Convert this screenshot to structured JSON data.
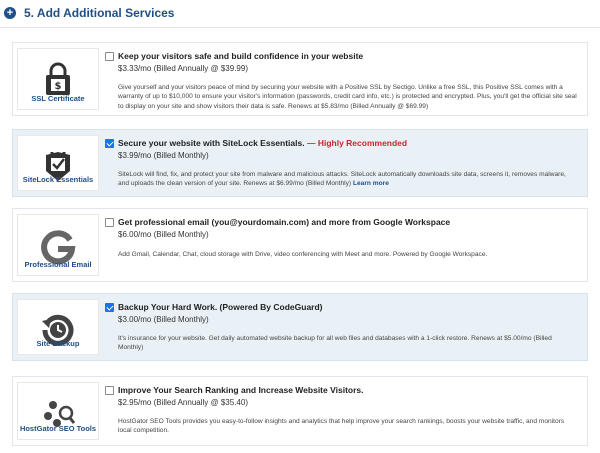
{
  "header": {
    "plus_glyph": "+",
    "title": "5. Add Additional Services"
  },
  "services": [
    {
      "label": "SSL Certificate",
      "icon": "lock-icon",
      "checked": false,
      "headline": "Keep your visitors safe and build confidence in your website",
      "recommended": "",
      "price": "$3.33/mo (Billed Annually @ $39.99)",
      "description": "Give yourself and your visitors peace of mind by securing your website with a Positive SSL by Sectigo. Unlike a free SSL, this Positive SSL comes with a warranty of up to $10,000 to ensure your visitor's information (passwords, credit card info, etc.) is protected and encrypted. Plus, you'll get the official site seal to display on your site and show visitors their data is safe. Renews at $5.83/mo (Billed Annually @ $69.99)",
      "more": ""
    },
    {
      "label": "SiteLock Essentials",
      "icon": "shield-check-icon",
      "checked": true,
      "headline": "Secure your website with SiteLock Essentials.",
      "recommended": "— Highly Recommended",
      "price": "$3.99/mo (Billed Monthly)",
      "description": "SiteLock will find, fix, and protect your site from malware and malicious attacks. SiteLock automatically downloads site data, screens it, removes malware, and uploads the clean version of your site. Renews at $6.99/mo (Billed Monthly)",
      "more": "Learn more"
    },
    {
      "label": "Professional Email",
      "icon": "google-g-icon",
      "checked": false,
      "headline": "Get professional email (you@yourdomain.com) and more from Google Workspace",
      "recommended": "",
      "price": "$6.00/mo (Billed Monthly)",
      "description": "Add Gmail, Calendar, Chat, cloud storage with Drive, video conferencing with Meet and more. Powered by Google Workspace.",
      "more": ""
    },
    {
      "label": "Site Backup",
      "icon": "backup-clock-icon",
      "checked": true,
      "headline": "Backup Your Hard Work. (Powered By CodeGuard)",
      "recommended": "",
      "price": "$3.00/mo (Billed Monthly)",
      "description": "It's insurance for your website. Get daily automated website backup for all web files and databases with a 1-click restore. Renews at $5.00/mo (Billed Monthly)",
      "more": ""
    },
    {
      "label": "HostGator SEO Tools",
      "icon": "seo-tools-icon",
      "checked": false,
      "headline": "Improve Your Search Ranking and Increase Website Visitors.",
      "recommended": "",
      "price": "$2.95/mo (Billed Annually @ $35.40)",
      "description": "HostGator SEO Tools provides you easy-to-follow insights and analytics that help improve your search rankings, boosts your website traffic, and monitors local competition.",
      "more": ""
    }
  ]
}
